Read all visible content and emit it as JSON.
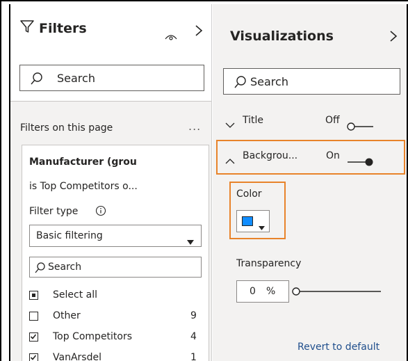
{
  "filters_pane": {
    "title": "Filters",
    "search_placeholder": "Search",
    "section_label": "Filters on this page",
    "more": "...",
    "card": {
      "field_name": "Manufacturer (grou",
      "condition": "is Top Competitors o...",
      "filter_type_label": "Filter type",
      "filter_type_value": "Basic filtering",
      "search_placeholder": "Search",
      "items": [
        {
          "label": "Select all",
          "count": "",
          "state": "partial"
        },
        {
          "label": "Other",
          "count": "9",
          "state": "unchecked"
        },
        {
          "label": "Top Competitors",
          "count": "4",
          "state": "checked"
        },
        {
          "label": "VanArsdel",
          "count": "1",
          "state": "checked"
        }
      ]
    }
  },
  "viz_pane": {
    "title": "Visualizations",
    "search_placeholder": "Search",
    "title_section": {
      "label": "Title",
      "state": "Off"
    },
    "background_section": {
      "label": "Backgrou...",
      "state": "On"
    },
    "color_label": "Color",
    "color_value": "#118dff",
    "transparency_label": "Transparency",
    "transparency_value": "0",
    "transparency_unit": "%",
    "revert_label": "Revert to default"
  },
  "colors": {
    "accent_highlight": "#e8832a",
    "pane_bg": "#f3f2f1",
    "link": "#1f4e8c"
  }
}
